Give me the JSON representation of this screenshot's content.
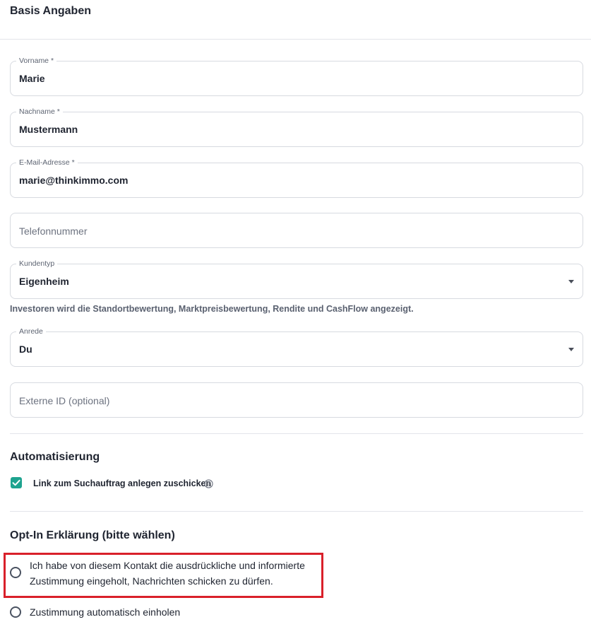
{
  "header": {
    "title": "Basis Angaben"
  },
  "fields": {
    "vorname": {
      "label": "Vorname *",
      "value": "Marie"
    },
    "nachname": {
      "label": "Nachname *",
      "value": "Mustermann"
    },
    "email": {
      "label": "E-Mail-Adresse *",
      "value": "marie@thinkimmo.com"
    },
    "telefon": {
      "placeholder": "Telefonnummer"
    },
    "kundentyp": {
      "label": "Kundentyp",
      "value": "Eigenheim"
    },
    "kundentyp_helper": "Investoren wird die Standortbewertung, Marktpreisbewertung, Rendite und CashFlow angezeigt.",
    "anrede": {
      "label": "Anrede",
      "value": "Du"
    },
    "externe_id": {
      "placeholder": "Externe ID (optional)"
    }
  },
  "automation": {
    "title": "Automatisierung",
    "checkbox_label": "Link zum Suchauftrag anlegen zuschicken",
    "checked": true,
    "checkbox_color": "#1ea38f"
  },
  "optin": {
    "title": "Opt-In Erklärung (bitte wählen)",
    "options": [
      {
        "line1": "Ich habe von diesem Kontakt die ausdrückliche und informierte",
        "line2": "Zustimmung eingeholt, Nachrichten schicken zu dürfen."
      },
      {
        "line1": "Zustimmung automatisch einholen"
      }
    ],
    "highlight_color": "#d9202a"
  }
}
